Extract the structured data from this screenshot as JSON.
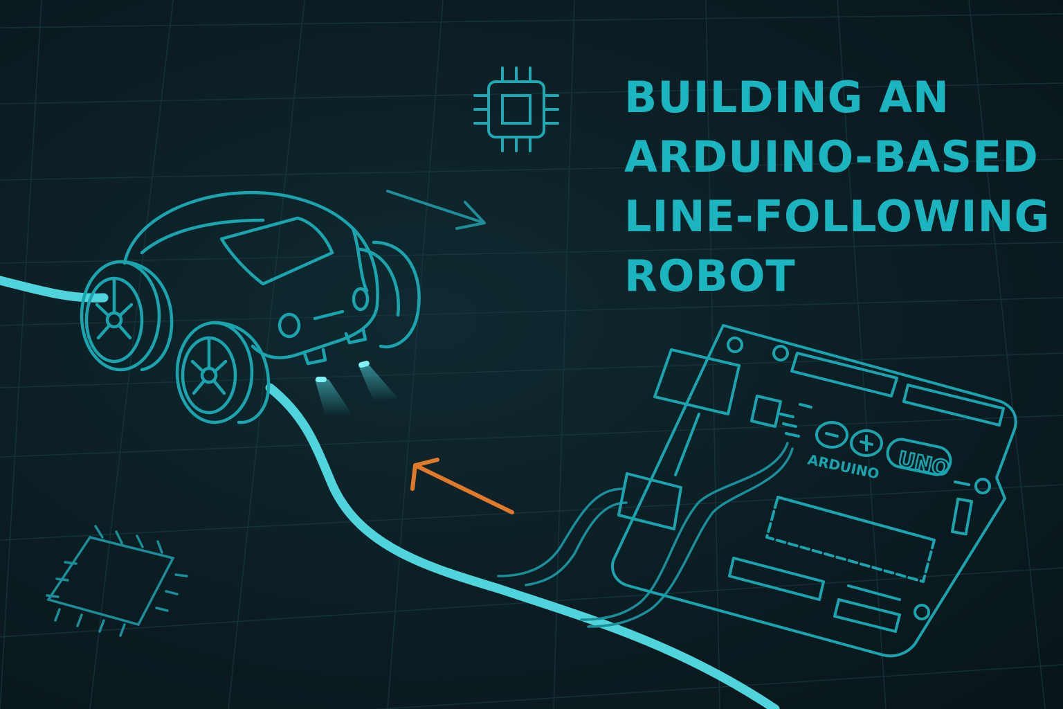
{
  "title": {
    "line1": "BUILDING AN",
    "line2": "ARDUINO-BASED",
    "line3": "LINE-FOLLOWING",
    "line4": "ROBOT"
  },
  "board": {
    "brand": "ARDUINO",
    "model": "UNO"
  },
  "icons": {
    "chip_top": "cpu-chip-icon",
    "chip_bottom": "chip-icon",
    "arrow_right": "arrow-right-icon",
    "arrow_back": "arrow-back-icon"
  },
  "colors": {
    "background": "#0b1c22",
    "accent": "#1bb5c0",
    "line": "#4fd4dc",
    "arrow_orange": "#e07a2a"
  }
}
